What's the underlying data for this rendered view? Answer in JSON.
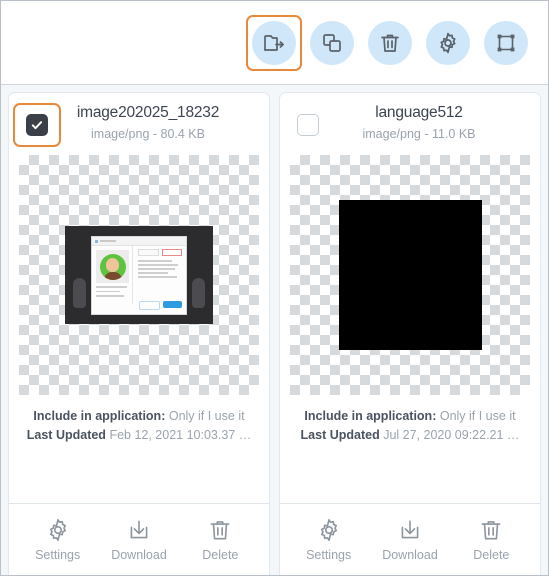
{
  "toolbar": {
    "items": [
      {
        "name": "export-folder",
        "icon": "folder-export-icon",
        "label": "Export",
        "selected": true
      },
      {
        "name": "duplicate",
        "icon": "copy-icon",
        "label": "Duplicate",
        "selected": false
      },
      {
        "name": "delete",
        "icon": "trash-icon",
        "label": "Delete",
        "selected": false
      },
      {
        "name": "settings",
        "icon": "gear-icon",
        "label": "Settings",
        "selected": false
      },
      {
        "name": "transform",
        "icon": "transform-handles-icon",
        "label": "Transform",
        "selected": false
      }
    ]
  },
  "colors": {
    "accent_selected": "#e8883a",
    "icon_button_bg": "#cfe7f9",
    "icon_stroke": "#5b626b",
    "card_bg": "#ffffff",
    "page_bg": "#f4f7fa",
    "label_muted": "#9aa3ad",
    "label_strong": "#4a5360",
    "checkbox_checked_bg": "#3a4048"
  },
  "cards": [
    {
      "checkbox": {
        "checked": true,
        "focused": true,
        "glyph": "check-icon"
      },
      "title": "image202025_18232",
      "meta": "image/png - 80.4 KB",
      "preview_kind": "screenshot-thumbnail",
      "info": {
        "include_label": "Include in application:",
        "include_value": "Only if I use it",
        "updated_label": "Last Updated",
        "updated_value": "Feb 12, 2021 10:03.37 …"
      },
      "actions": [
        {
          "name": "settings",
          "icon": "gear-icon",
          "label": "Settings"
        },
        {
          "name": "download",
          "icon": "download-icon",
          "label": "Download"
        },
        {
          "name": "delete",
          "icon": "trash-icon",
          "label": "Delete"
        }
      ]
    },
    {
      "checkbox": {
        "checked": false,
        "focused": false,
        "glyph": "check-icon"
      },
      "title": "language512",
      "meta": "image/png - 11.0 KB",
      "preview_kind": "black-square",
      "info": {
        "include_label": "Include in application:",
        "include_value": "Only if I use it",
        "updated_label": "Last Updated",
        "updated_value": "Jul 27, 2020 09:22.21 …"
      },
      "actions": [
        {
          "name": "settings",
          "icon": "gear-icon",
          "label": "Settings"
        },
        {
          "name": "download",
          "icon": "download-icon",
          "label": "Download"
        },
        {
          "name": "delete",
          "icon": "trash-icon",
          "label": "Delete"
        }
      ]
    }
  ]
}
